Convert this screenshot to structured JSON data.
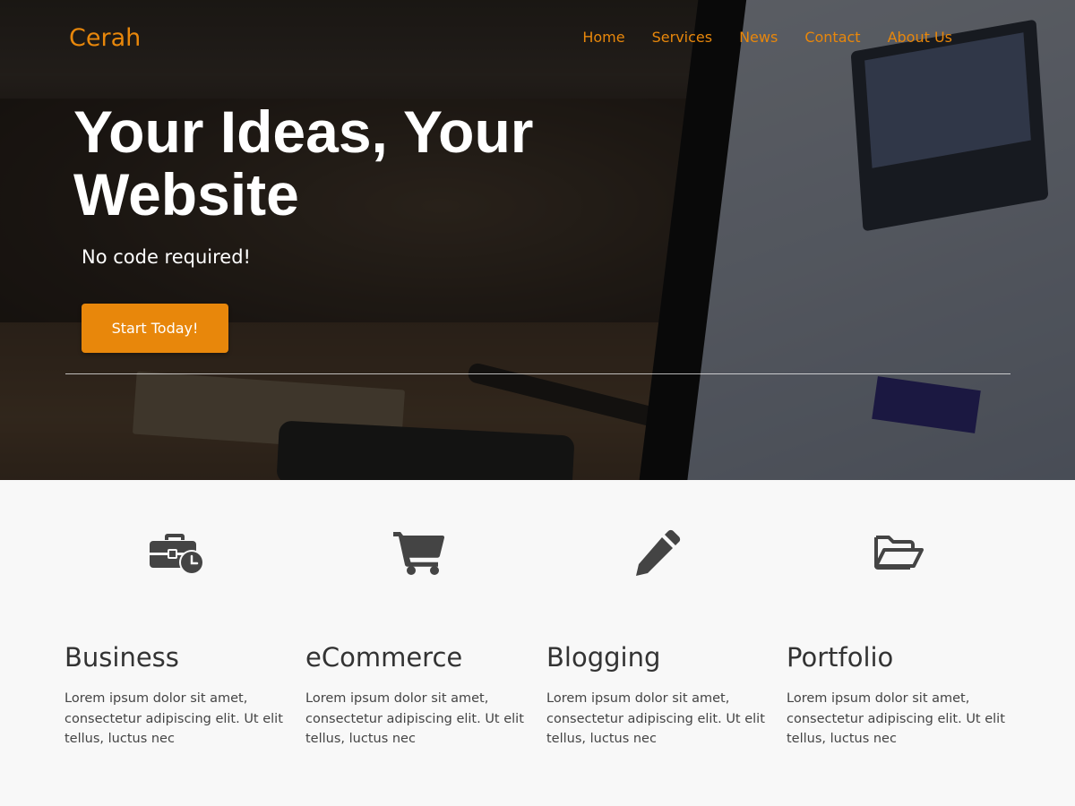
{
  "brand": {
    "name": "Cerah",
    "accent_color": "#e8870b"
  },
  "nav": {
    "items": [
      {
        "label": "Home"
      },
      {
        "label": "Services"
      },
      {
        "label": "News"
      },
      {
        "label": "Contact"
      },
      {
        "label": "About Us"
      }
    ]
  },
  "hero": {
    "headline": "Your Ideas, Your Website",
    "subheadline": "No code required!",
    "cta_label": "Start Today!"
  },
  "features": [
    {
      "icon": "briefcase-clock-icon",
      "title": "Business",
      "text": "Lorem ipsum dolor sit amet, consectetur adipiscing elit. Ut elit tellus, luctus nec"
    },
    {
      "icon": "shopping-cart-icon",
      "title": "eCommerce",
      "text": "Lorem ipsum dolor sit amet, consectetur adipiscing elit. Ut elit tellus, luctus nec"
    },
    {
      "icon": "pencil-icon",
      "title": "Blogging",
      "text": "Lorem ipsum dolor sit amet, consectetur adipiscing elit. Ut elit tellus, luctus nec"
    },
    {
      "icon": "folder-open-icon",
      "title": "Portfolio",
      "text": "Lorem ipsum dolor sit amet, consectetur adipiscing elit. Ut elit tellus, luctus nec"
    }
  ],
  "colors": {
    "icon_color": "#444444",
    "heading_color": "#333333",
    "section_background": "#f8f8f8"
  }
}
